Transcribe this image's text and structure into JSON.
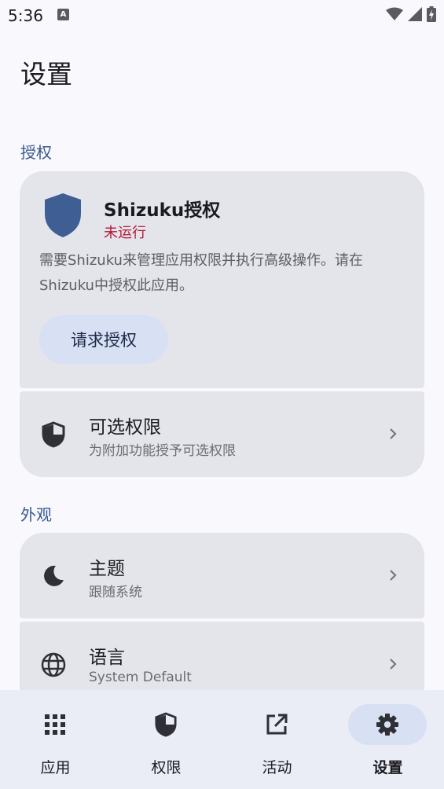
{
  "status_bar": {
    "time": "5:36",
    "notification_icon_letter": "A"
  },
  "page_title": "设置",
  "sections": {
    "authorization": "授权",
    "appearance": "外观"
  },
  "shizuku_card": {
    "title": "Shizuku授权",
    "status": "未运行",
    "description": "需要Shizuku来管理应用权限并执行高级操作。请在Shizuku中授权此应用。",
    "button_label": "请求授权",
    "status_color": "#b3183a",
    "shield_color": "#3f5f94"
  },
  "optional_permissions": {
    "title": "可选权限",
    "subtitle": "为附加功能授予可选权限",
    "icon": "shield-half-icon"
  },
  "theme": {
    "title": "主题",
    "subtitle": "跟随系统",
    "icon": "moon-icon"
  },
  "language": {
    "title": "语言",
    "subtitle": "System Default",
    "icon": "globe-icon"
  },
  "bottom_nav": {
    "items": [
      {
        "label": "应用",
        "icon": "apps-grid-icon",
        "active": false
      },
      {
        "label": "权限",
        "icon": "shield-icon",
        "active": false
      },
      {
        "label": "活动",
        "icon": "open-in-new-icon",
        "active": false
      },
      {
        "label": "设置",
        "icon": "gear-icon",
        "active": true
      }
    ]
  },
  "colors": {
    "accent": "#3b5a8f",
    "card_bg": "#e4e5ea",
    "nav_active_pill": "#d8e0f4"
  }
}
